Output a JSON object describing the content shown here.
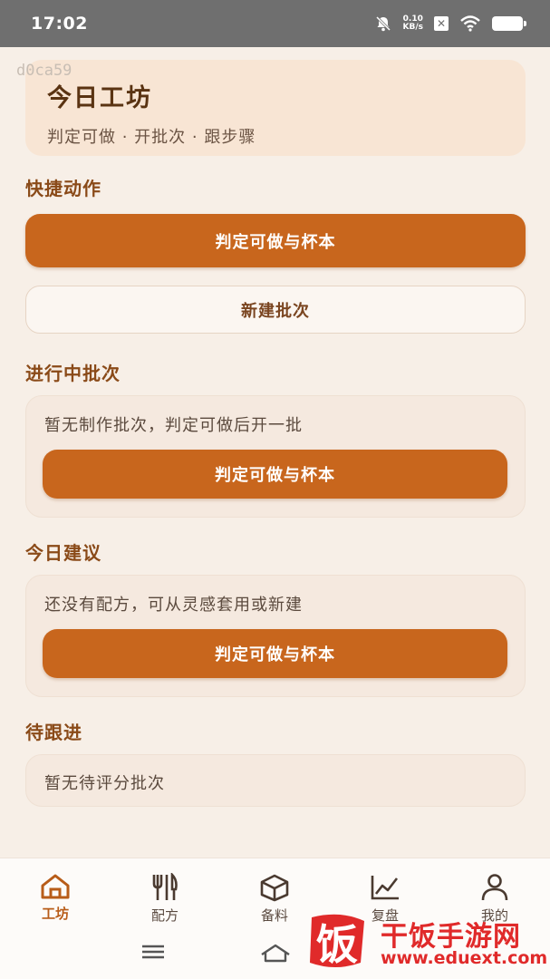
{
  "status_bar": {
    "time": "17:02",
    "net_speed_value": "0.10",
    "net_speed_unit": "KB/s"
  },
  "watermark_top": "d0ca59",
  "hero": {
    "title": "今日工坊",
    "subtitle": "判定可做 · 开批次 · 跟步骤"
  },
  "quick_actions": {
    "title": "快捷动作",
    "primary_label": "判定可做与杯本",
    "secondary_label": "新建批次"
  },
  "in_progress": {
    "title": "进行中批次",
    "empty_text": "暂无制作批次，判定可做后开一批",
    "button_label": "判定可做与杯本"
  },
  "suggestions": {
    "title": "今日建议",
    "empty_text": "还没有配方，可从灵感套用或新建",
    "button_label": "判定可做与杯本"
  },
  "followup": {
    "title": "待跟进",
    "empty_text": "暂无待评分批次"
  },
  "tabs": [
    {
      "label": "工坊",
      "icon": "home-icon",
      "active": true
    },
    {
      "label": "配方",
      "icon": "fork-knife-icon",
      "active": false
    },
    {
      "label": "备料",
      "icon": "box-icon",
      "active": false
    },
    {
      "label": "复盘",
      "icon": "chart-icon",
      "active": false
    },
    {
      "label": "我的",
      "icon": "user-icon",
      "active": false
    }
  ],
  "watermark_brand": {
    "logo_char": "饭",
    "text": "干饭手游网",
    "url": "www.eduext.com"
  },
  "colors": {
    "accent": "#c8661d",
    "section_title": "#8a4a18",
    "hero_bg": "#f8e5d4",
    "page_bg": "#f7efe7",
    "watermark": "#e02a2a"
  }
}
